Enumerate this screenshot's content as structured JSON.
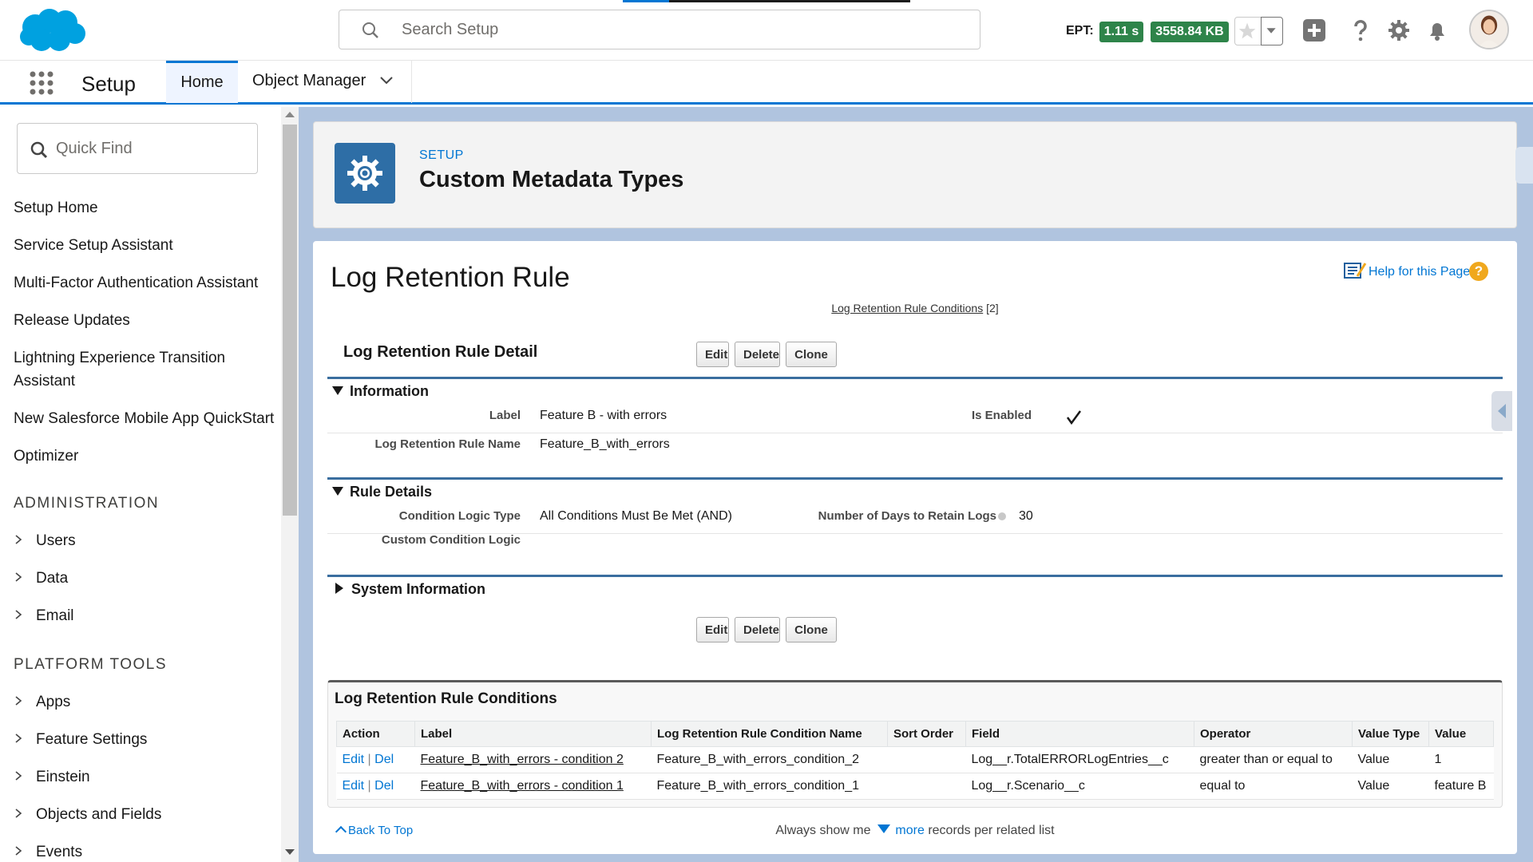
{
  "header": {
    "search_placeholder": "Search Setup",
    "ept_label": "EPT:",
    "ept_time": "1.11 s",
    "ept_size": "3558.84 KB",
    "load_progress_percent": 16
  },
  "nav": {
    "app_title": "Setup",
    "tabs": [
      {
        "label": "Home"
      },
      {
        "label": "Object Manager"
      }
    ]
  },
  "sidebar": {
    "quick_find_placeholder": "Quick Find",
    "items": [
      {
        "label": "Setup Home"
      },
      {
        "label": "Service Setup Assistant"
      },
      {
        "label": "Multi-Factor Authentication Assistant"
      },
      {
        "label": "Release Updates"
      },
      {
        "label": "Lightning Experience Transition Assistant"
      },
      {
        "label": "New Salesforce Mobile App QuickStart"
      },
      {
        "label": "Optimizer"
      }
    ],
    "section_admin": "ADMINISTRATION",
    "admin_items": [
      {
        "label": "Users"
      },
      {
        "label": "Data"
      },
      {
        "label": "Email"
      }
    ],
    "section_platform": "PLATFORM TOOLS",
    "platform_items": [
      {
        "label": "Apps"
      },
      {
        "label": "Feature Settings"
      },
      {
        "label": "Einstein"
      },
      {
        "label": "Objects and Fields"
      },
      {
        "label": "Events"
      }
    ]
  },
  "page_header": {
    "breadcrumb": "SETUP",
    "title": "Custom Metadata Types"
  },
  "record": {
    "title": "Log Retention Rule",
    "help_label": "Help for this Page",
    "related_link": "Log Retention Rule Conditions",
    "related_count": "[2]",
    "detail_title": "Log Retention Rule Detail",
    "buttons": {
      "edit": "Edit",
      "delete": "Delete",
      "clone": "Clone"
    },
    "sections": {
      "information": "Information",
      "rule_details": "Rule Details",
      "system_information": "System Information"
    },
    "fields": {
      "label_label": "Label",
      "label_value": "Feature B - with errors",
      "is_enabled_label": "Is Enabled",
      "name_label": "Log Retention Rule Name",
      "name_value": "Feature_B_with_errors",
      "logic_type_label": "Condition Logic Type",
      "logic_type_value": "All Conditions Must Be Met (AND)",
      "days_label": "Number of Days to Retain Logs",
      "days_value": "30",
      "custom_logic_label": "Custom Condition Logic",
      "custom_logic_value": ""
    }
  },
  "related_list": {
    "title": "Log Retention Rule Conditions",
    "columns": [
      "Action",
      "Label",
      "Log Retention Rule Condition Name",
      "Sort Order",
      "Field",
      "Operator",
      "Value Type",
      "Value"
    ],
    "edit_label": "Edit",
    "sep": "|",
    "del_label": "Del",
    "rows": [
      {
        "label": "Feature_B_with_errors - condition 2",
        "name": "Feature_B_with_errors_condition_2",
        "sort_order": "",
        "field": "Log__r.TotalERRORLogEntries__c",
        "operator": "greater than or equal to",
        "value_type": "Value",
        "value": "1"
      },
      {
        "label": "Feature_B_with_errors - condition 1",
        "name": "Feature_B_with_errors_condition_1",
        "sort_order": "",
        "field": "Log__r.Scenario__c",
        "operator": "equal to",
        "value_type": "Value",
        "value": "feature B"
      }
    ]
  },
  "footer": {
    "back_to_top": "Back To Top",
    "always_show": "Always show me",
    "more": "more",
    "records_per": "records per related list"
  }
}
